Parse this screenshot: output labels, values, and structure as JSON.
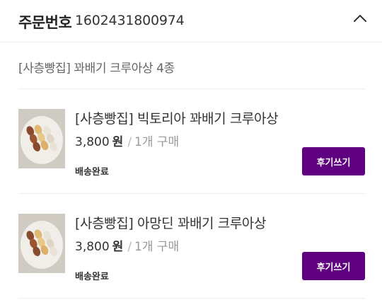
{
  "header": {
    "order_label": "주문번호",
    "order_number": "1602431800974"
  },
  "shop_summary": "[사층빵집] 꽈배기 크루아상 4종",
  "items": [
    {
      "name": "[사층빵집] 빅토리아 꽈배기 크루아상",
      "price": "3,800",
      "currency": "원",
      "separator": "/",
      "quantity": "1개 구매",
      "status": "배송완료",
      "review_label": "후기쓰기"
    },
    {
      "name": "[사층빵집] 아망딘 꽈배기 크루아상",
      "price": "3,800",
      "currency": "원",
      "separator": "/",
      "quantity": "1개 구매",
      "status": "배송완료",
      "review_label": "후기쓰기"
    }
  ],
  "colors": {
    "accent": "#5f0080",
    "divider": "#eeeeee"
  },
  "icons": {
    "collapse": "chevron-up-icon"
  }
}
